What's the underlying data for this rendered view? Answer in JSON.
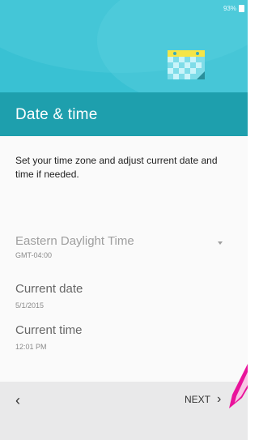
{
  "status_bar": {
    "battery_text": "93%"
  },
  "header": {
    "title": "Date & time",
    "icon": "calendar-icon"
  },
  "content": {
    "intro": "Set your time zone and adjust current date and time if needed.",
    "timezone": {
      "label": "Eastern Daylight Time",
      "sub": "GMT-04:00",
      "icon": "dropdown-arrow-icon"
    },
    "current_date": {
      "label": "Current date",
      "value": "5/1/2015"
    },
    "current_time": {
      "label": "Current time",
      "value": "12:01 PM"
    }
  },
  "footer": {
    "back_glyph": "‹",
    "next_label": "NEXT",
    "next_glyph": "›"
  },
  "colors": {
    "hero": "#39c1d3",
    "title_bar": "#1e9fad",
    "accent_pink": "#e9139b"
  }
}
